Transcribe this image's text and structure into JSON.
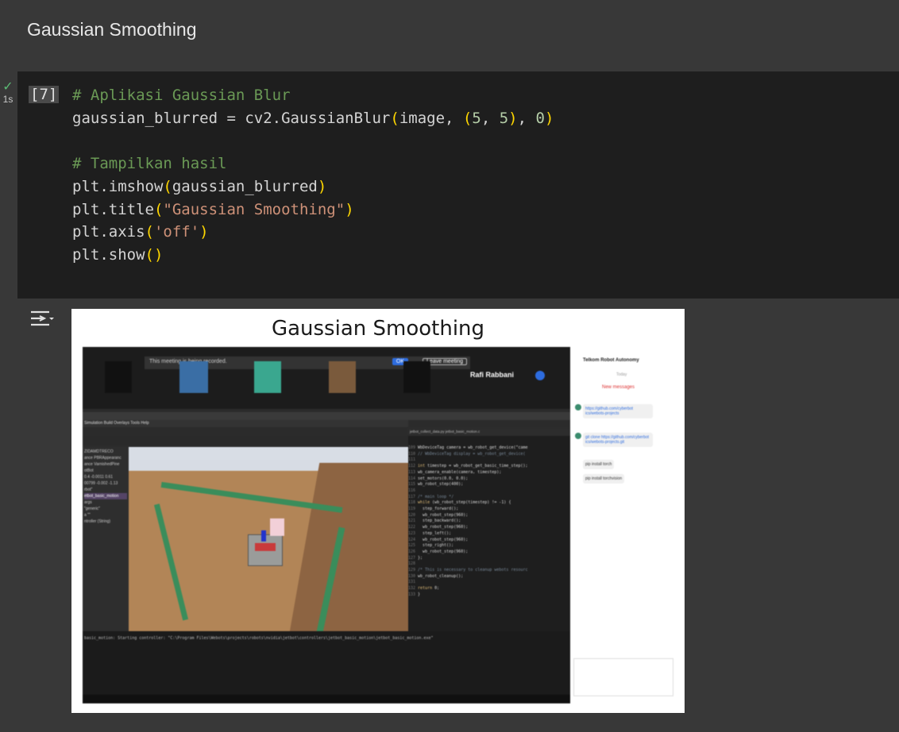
{
  "section": {
    "title": "Gaussian Smoothing"
  },
  "cell": {
    "status": {
      "check": "✓",
      "duration": "1s"
    },
    "execution_count": "[7]",
    "code_lines": [
      "# Aplikasi Gaussian Blur",
      "gaussian_blurred = cv2.GaussianBlur(image, (5, 5), 0)",
      "",
      "# Tampilkan hasil",
      "plt.imshow(gaussian_blurred)",
      "plt.title(\"Gaussian Smoothing\")",
      "plt.axis('off')",
      "plt.show()"
    ]
  },
  "output": {
    "toggle_icon": "output-toggle-icon",
    "figure_title": "Gaussian Smoothing",
    "image": {
      "meeting_banner": "This meeting is being recorded.",
      "ok_label": "OK",
      "leave_label": "Leave meeting",
      "speaker": "Rafi Rabbani",
      "chat_title": "Telkom Robot Autonomy",
      "chat_today": "Today",
      "chat_new": "New messages",
      "chat_msgs": [
        "https://github.com/cyberbot ics/webots-projects",
        "git clone https://github.com/cyberbot ics/webots-projects.git",
        "pip install torch",
        "pip install torchvision"
      ],
      "menu": "Simulation  Build  Overlays  Tools  Help",
      "console": "basic_motion: Starting controller: \"C:\\Program Files\\Webots\\projects\\robots\\nvidia\\jetbot\\controllers\\jetbot_basic_motion\\jetbot_basic_motion.exe\""
    }
  }
}
